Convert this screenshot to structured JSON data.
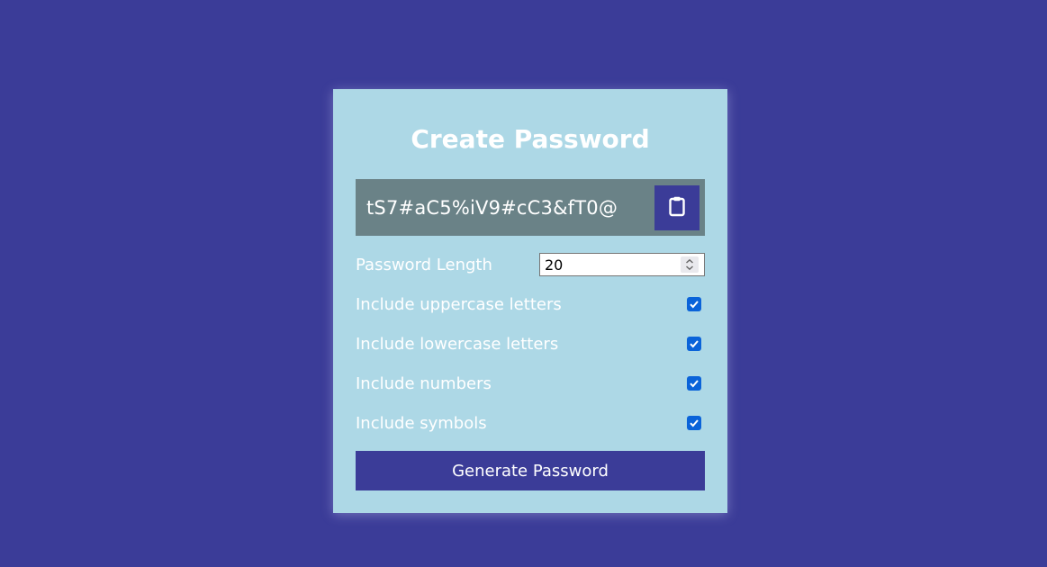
{
  "title": "Create Password",
  "result": {
    "password": "tS7#aC5%iV9#cC3&fT0@",
    "copy_icon": "clipboard-icon"
  },
  "settings": {
    "length_label": "Password Length",
    "length_value": "20",
    "uppercase_label": "Include uppercase letters",
    "uppercase_checked": true,
    "lowercase_label": "Include lowercase letters",
    "lowercase_checked": true,
    "numbers_label": "Include numbers",
    "numbers_checked": true,
    "symbols_label": "Include symbols",
    "symbols_checked": true
  },
  "generate_button": "Generate Password",
  "colors": {
    "background": "#3b3c98",
    "card": "#add8e6",
    "result_bg": "#6a8287",
    "button": "#3b3c98",
    "checkbox": "#0a63d9"
  }
}
